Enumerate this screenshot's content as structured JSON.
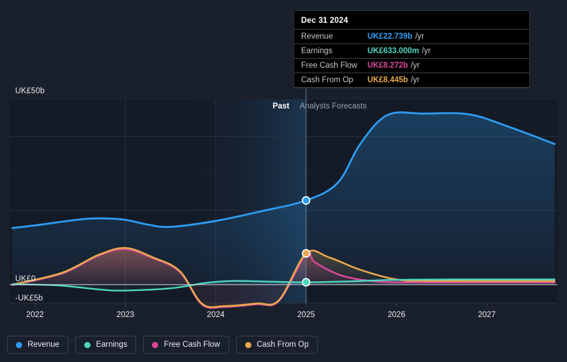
{
  "tooltip": {
    "title": "Dec 31 2024",
    "rows": [
      {
        "name": "Revenue",
        "value": "UK£22.739b",
        "unit": "/yr",
        "color": "#2e9bf0"
      },
      {
        "name": "Earnings",
        "value": "UK£633.000m",
        "unit": "/yr",
        "color": "#4fd6c0"
      },
      {
        "name": "Free Cash Flow",
        "value": "UK£8.272b",
        "unit": "/yr",
        "color": "#e0469a"
      },
      {
        "name": "Cash From Op",
        "value": "UK£8.445b",
        "unit": "/yr",
        "color": "#e8a council"
      }
    ]
  },
  "phase": {
    "past": "Past",
    "forecast": "Analysts Forecasts"
  },
  "legend": [
    {
      "label": "Revenue",
      "color": "#2e9bf0"
    },
    {
      "label": "Earnings",
      "color": "#4fd6c0"
    },
    {
      "label": "Free Cash Flow",
      "color": "#d9479b"
    },
    {
      "label": "Cash From Op",
      "color": "#e8a84c"
    }
  ],
  "chart_data": {
    "type": "area",
    "title": "",
    "xlabel": "",
    "ylabel": "",
    "ylim": [
      -5,
      50
    ],
    "ytick_labels": [
      "UK£50b",
      "UK£0",
      "-UK£5b"
    ],
    "ytick_values": [
      50,
      0,
      -5
    ],
    "xtick_labels": [
      "2022",
      "2023",
      "2024",
      "2025",
      "2026",
      "2027"
    ],
    "x": [
      2022,
      2023,
      2024,
      2025,
      2026,
      2027
    ],
    "grid": true,
    "legend_position": "bottom",
    "forecast_start": 2025,
    "series": [
      {
        "name": "Revenue",
        "color": "#2e9bf0",
        "values": [
          16.0,
          17.5,
          15.8,
          22.739,
          46.0,
          45.5
        ],
        "points": [
          {
            "x": 2021.75,
            "y": 15.3
          },
          {
            "x": 2022.0,
            "y": 16.0
          },
          {
            "x": 2022.5,
            "y": 17.6
          },
          {
            "x": 2022.75,
            "y": 17.9
          },
          {
            "x": 2023.0,
            "y": 17.5
          },
          {
            "x": 2023.25,
            "y": 16.2
          },
          {
            "x": 2023.5,
            "y": 15.6
          },
          {
            "x": 2024.0,
            "y": 17.2
          },
          {
            "x": 2024.5,
            "y": 19.8
          },
          {
            "x": 2025.0,
            "y": 22.739
          },
          {
            "x": 2025.35,
            "y": 27.5
          },
          {
            "x": 2025.6,
            "y": 38.0
          },
          {
            "x": 2025.9,
            "y": 45.8
          },
          {
            "x": 2026.3,
            "y": 46.2
          },
          {
            "x": 2026.8,
            "y": 46.0
          },
          {
            "x": 2027.2,
            "y": 43.0
          },
          {
            "x": 2027.75,
            "y": 38.0
          }
        ]
      },
      {
        "name": "Earnings",
        "color": "#4fd6c0",
        "values": [
          0.2,
          -1.6,
          0.9,
          0.633,
          1.4,
          1.4
        ],
        "points": [
          {
            "x": 2021.75,
            "y": 0.1
          },
          {
            "x": 2022.25,
            "y": -0.2
          },
          {
            "x": 2022.75,
            "y": -1.4
          },
          {
            "x": 2023.0,
            "y": -1.6
          },
          {
            "x": 2023.5,
            "y": -1.0
          },
          {
            "x": 2023.9,
            "y": 0.5
          },
          {
            "x": 2024.2,
            "y": 1.0
          },
          {
            "x": 2024.6,
            "y": 0.8
          },
          {
            "x": 2025.0,
            "y": 0.633
          },
          {
            "x": 2025.5,
            "y": 0.9
          },
          {
            "x": 2026.0,
            "y": 1.3
          },
          {
            "x": 2026.6,
            "y": 1.4
          },
          {
            "x": 2027.75,
            "y": 1.4
          }
        ]
      },
      {
        "name": "Free Cash Flow",
        "color": "#d9479b",
        "values": [
          0.0,
          9.5,
          -6.0,
          8.272,
          0.6,
          0.6
        ],
        "points": [
          {
            "x": 2021.75,
            "y": -0.1
          },
          {
            "x": 2022.3,
            "y": 3.0
          },
          {
            "x": 2022.7,
            "y": 7.8
          },
          {
            "x": 2023.0,
            "y": 9.6
          },
          {
            "x": 2023.3,
            "y": 7.2
          },
          {
            "x": 2023.6,
            "y": 3.5
          },
          {
            "x": 2023.85,
            "y": -5.4
          },
          {
            "x": 2024.1,
            "y": -6.0
          },
          {
            "x": 2024.45,
            "y": -5.3
          },
          {
            "x": 2024.7,
            "y": -4.4
          },
          {
            "x": 2025.0,
            "y": 8.272
          },
          {
            "x": 2025.1,
            "y": 6.0
          },
          {
            "x": 2025.4,
            "y": 2.4
          },
          {
            "x": 2025.8,
            "y": 0.8
          },
          {
            "x": 2026.3,
            "y": 0.6
          },
          {
            "x": 2027.75,
            "y": 0.6
          }
        ]
      },
      {
        "name": "Cash From Op",
        "color": "#e8a84c",
        "values": [
          0.1,
          9.8,
          -5.8,
          8.445,
          0.9,
          0.9
        ],
        "points": [
          {
            "x": 2021.75,
            "y": 0.0
          },
          {
            "x": 2022.3,
            "y": 3.2
          },
          {
            "x": 2022.7,
            "y": 8.0
          },
          {
            "x": 2023.0,
            "y": 9.9
          },
          {
            "x": 2023.3,
            "y": 7.4
          },
          {
            "x": 2023.6,
            "y": 3.7
          },
          {
            "x": 2023.85,
            "y": -5.2
          },
          {
            "x": 2024.1,
            "y": -5.8
          },
          {
            "x": 2024.45,
            "y": -5.1
          },
          {
            "x": 2024.7,
            "y": -4.2
          },
          {
            "x": 2025.0,
            "y": 8.445
          },
          {
            "x": 2025.25,
            "y": 7.4
          },
          {
            "x": 2025.6,
            "y": 4.0
          },
          {
            "x": 2026.0,
            "y": 1.4
          },
          {
            "x": 2026.4,
            "y": 1.0
          },
          {
            "x": 2027.75,
            "y": 0.95
          }
        ]
      }
    ],
    "markers": [
      {
        "series": "Revenue",
        "x": 2025,
        "y": 22.739,
        "color": "#2e9bf0"
      },
      {
        "series": "Cash From Op",
        "x": 2025,
        "y": 8.445,
        "color": "#e8a84c"
      },
      {
        "series": "Earnings",
        "x": 2025,
        "y": 0.633,
        "color": "#4fd6c0"
      }
    ]
  }
}
